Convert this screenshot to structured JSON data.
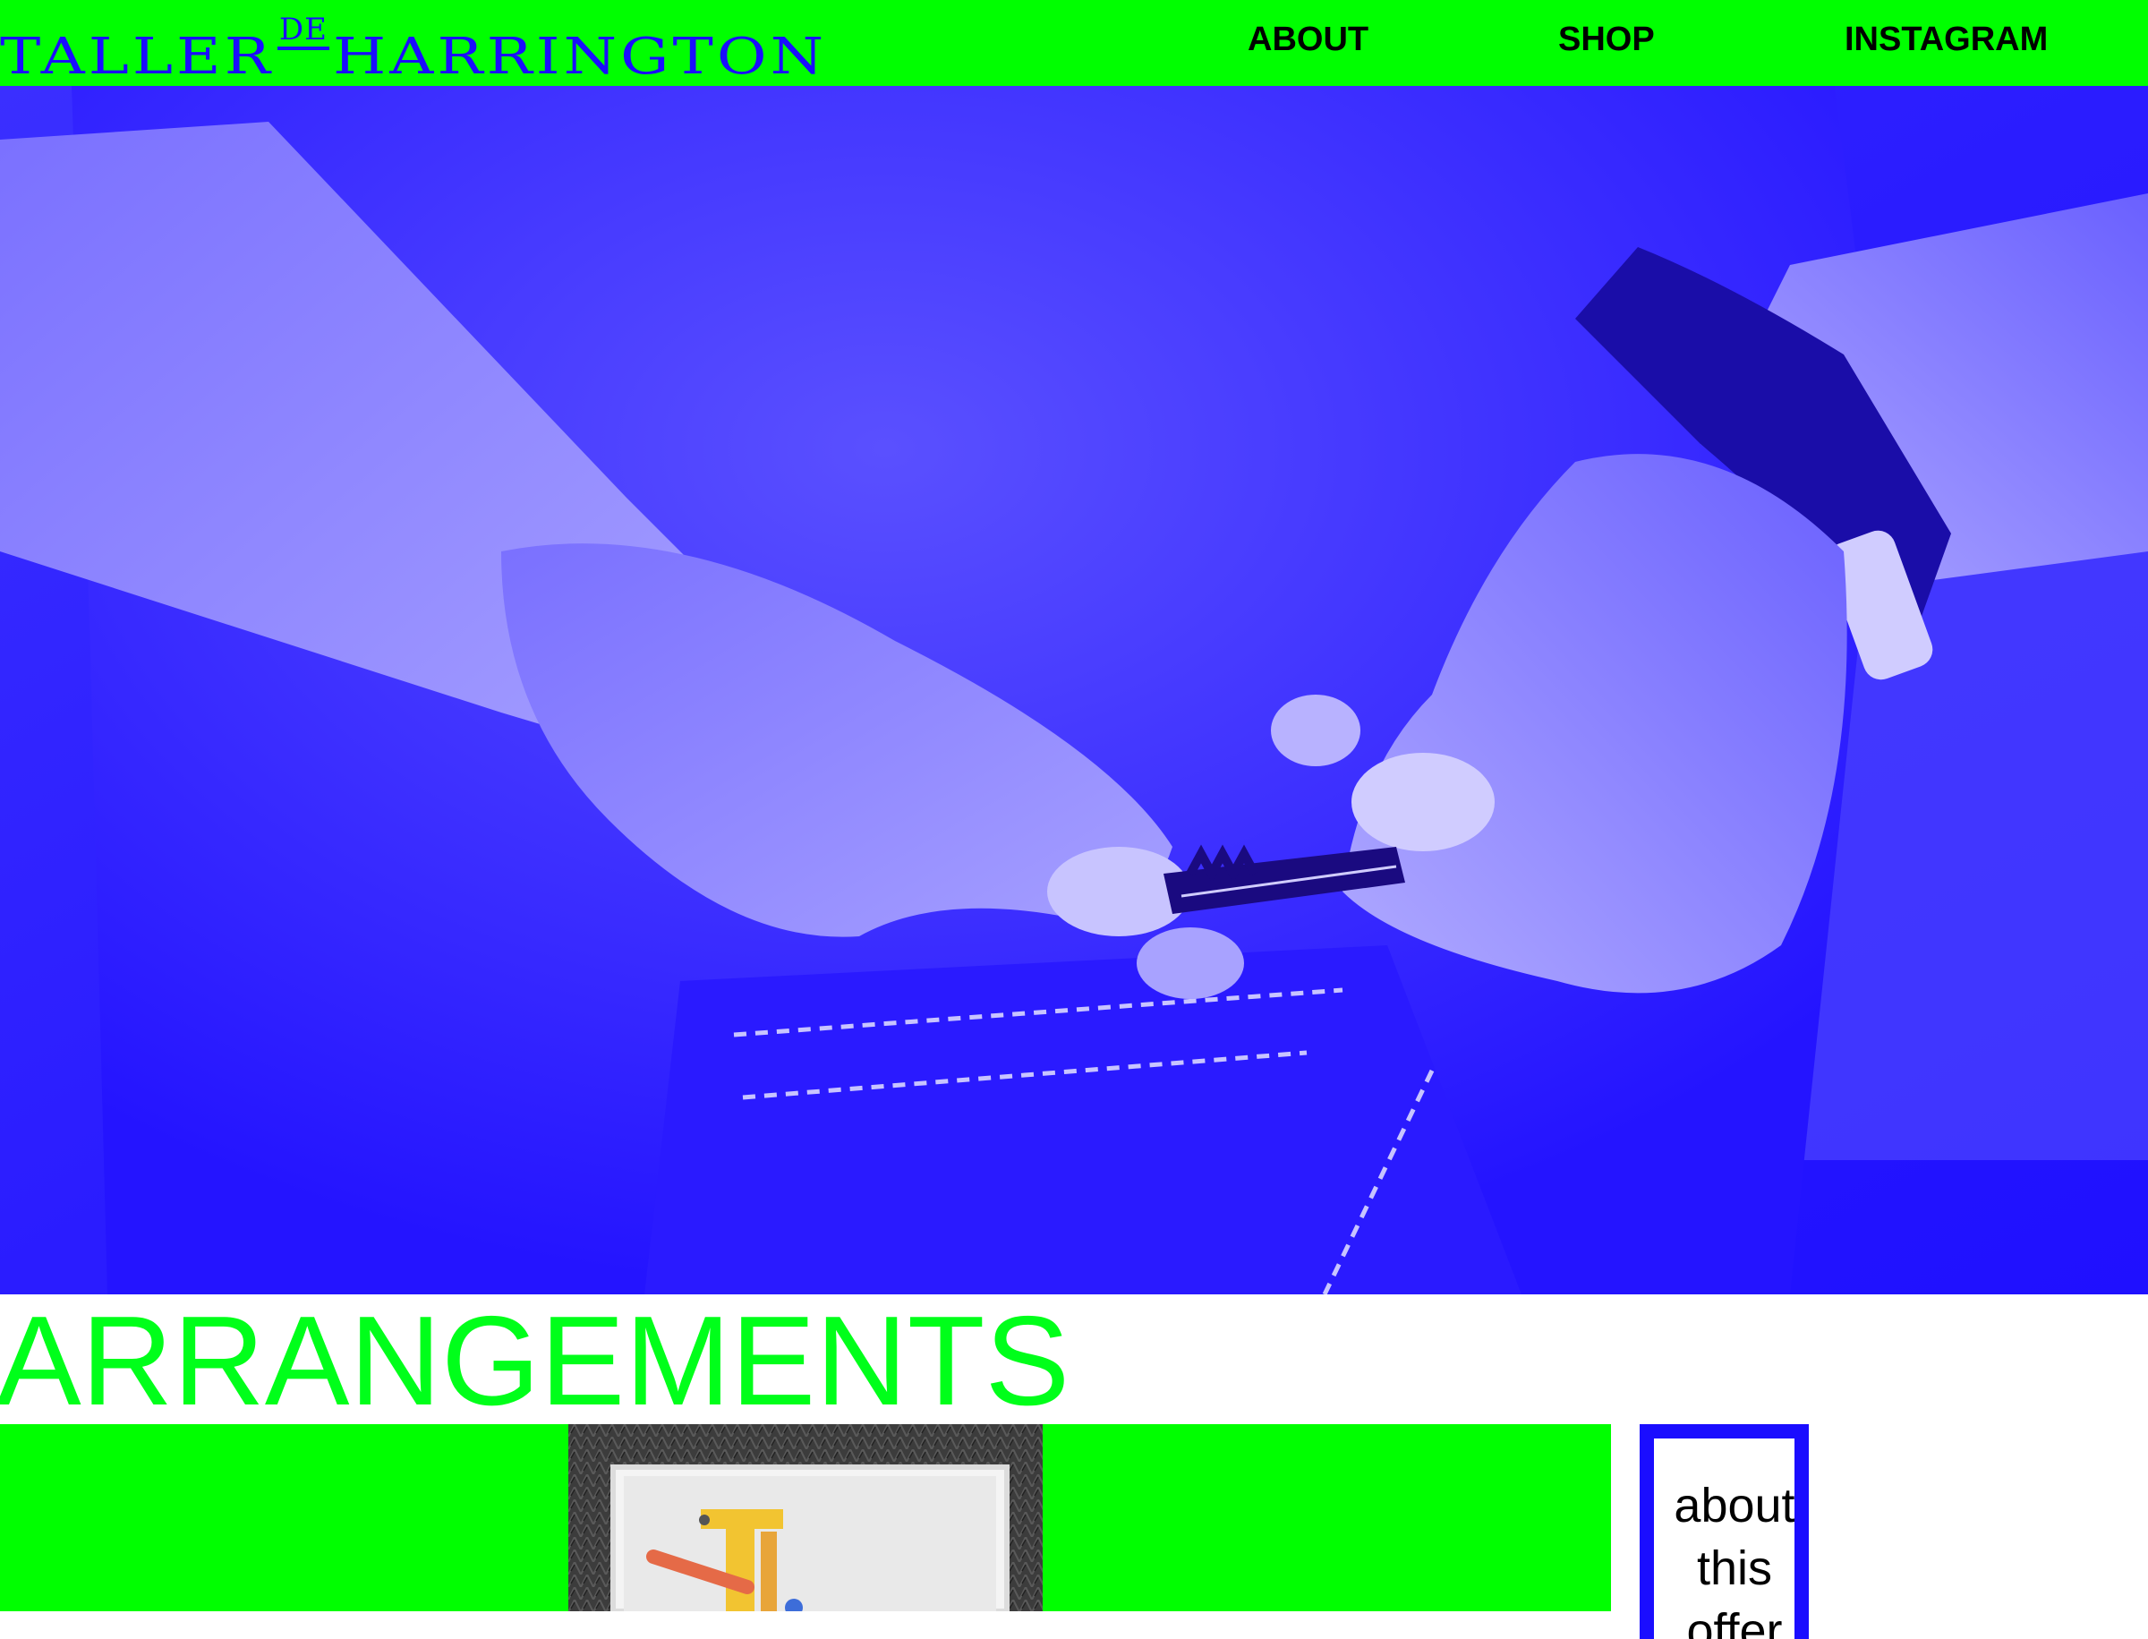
{
  "brand": {
    "part1": "TALLER",
    "part2": "DE",
    "part3": "HARRINGTON"
  },
  "nav": {
    "items": [
      {
        "label": "ABOUT"
      },
      {
        "label": "SHOP"
      },
      {
        "label": "INSTAGRAM"
      }
    ]
  },
  "hero": {
    "image": "hands-holding-key-photo"
  },
  "section": {
    "title": "ARRANGEMENTS"
  },
  "product": {
    "thumbnail": "framed-artwork-on-fur-photo"
  },
  "about_box": {
    "text": "about this offer"
  },
  "colors": {
    "accent_green": "#00ff00",
    "brand_blue": "#1a0dff",
    "title_green": "#00ff1a"
  }
}
